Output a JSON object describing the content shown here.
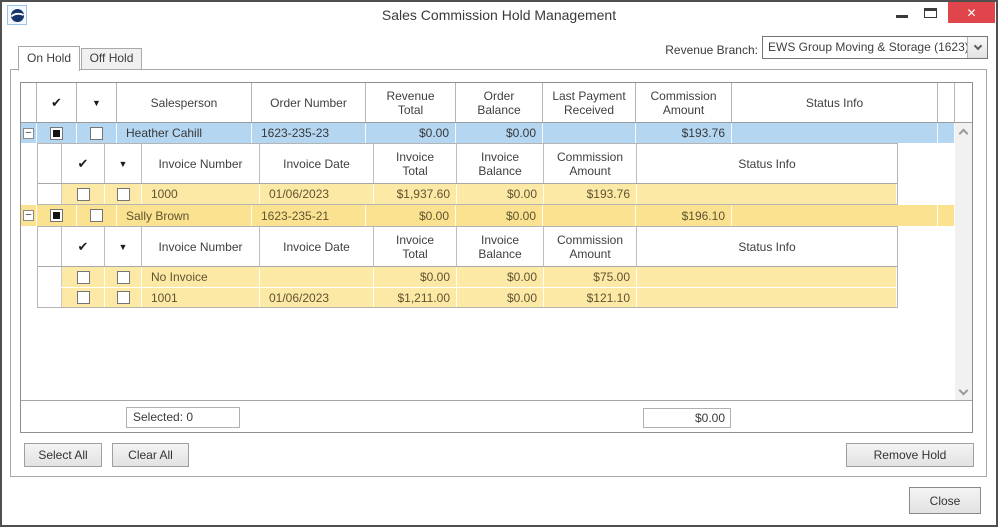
{
  "titlebar": {
    "title": "Sales Commission Hold Management"
  },
  "icons": {
    "check": "✔",
    "dropdown": "▼",
    "collapse": "−",
    "close": "✕"
  },
  "tabs": {
    "on_hold": "On Hold",
    "off_hold": "Off Hold"
  },
  "revenue_branch": {
    "label": "Revenue Branch:",
    "selected": "EWS Group Moving & Storage (1623)"
  },
  "grid": {
    "headers": {
      "salesperson": "Salesperson",
      "order_number": "Order Number",
      "revenue_total": "Revenue\nTotal",
      "order_balance": "Order\nBalance",
      "last_payment_received": "Last Payment\nReceived",
      "commission_amount": "Commission\nAmount",
      "status_info": "Status Info"
    },
    "sub_headers": {
      "invoice_number": "Invoice Number",
      "invoice_date": "Invoice Date",
      "invoice_total": "Invoice\nTotal",
      "invoice_balance": "Invoice\nBalance",
      "commission_amount": "Commission\nAmount",
      "status_info": "Status Info"
    },
    "groups": [
      {
        "salesperson": "Heather Cahill",
        "order_number": "1623-235-23",
        "revenue_total": "$0.00",
        "order_balance": "$0.00",
        "last_payment_received": "",
        "commission_amount": "$193.76",
        "status_info": "",
        "invoices": [
          {
            "invoice_number": "1000",
            "invoice_date": "01/06/2023",
            "invoice_total": "$1,937.60",
            "invoice_balance": "$0.00",
            "commission_amount": "$193.76",
            "status_info": ""
          }
        ]
      },
      {
        "salesperson": "Sally Brown",
        "order_number": "1623-235-21",
        "revenue_total": "$0.00",
        "order_balance": "$0.00",
        "last_payment_received": "",
        "commission_amount": "$196.10",
        "status_info": "",
        "invoices": [
          {
            "invoice_number": "No Invoice",
            "invoice_date": "",
            "invoice_total": "$0.00",
            "invoice_balance": "$0.00",
            "commission_amount": "$75.00",
            "status_info": ""
          },
          {
            "invoice_number": "1001",
            "invoice_date": "01/06/2023",
            "invoice_total": "$1,211.00",
            "invoice_balance": "$0.00",
            "commission_amount": "$121.10",
            "status_info": ""
          }
        ]
      }
    ],
    "footer": {
      "selected": "Selected: 0",
      "total": "$0.00"
    }
  },
  "buttons": {
    "select_all": "Select All",
    "clear_all": "Clear All",
    "remove_hold": "Remove Hold",
    "close": "Close"
  },
  "colors": {
    "selected_row_blue": "#b5d6f0",
    "group_row_yellow": "#fae291",
    "invoice_row_yellow": "#fce9a6",
    "close_button_red": "#e0454b"
  }
}
